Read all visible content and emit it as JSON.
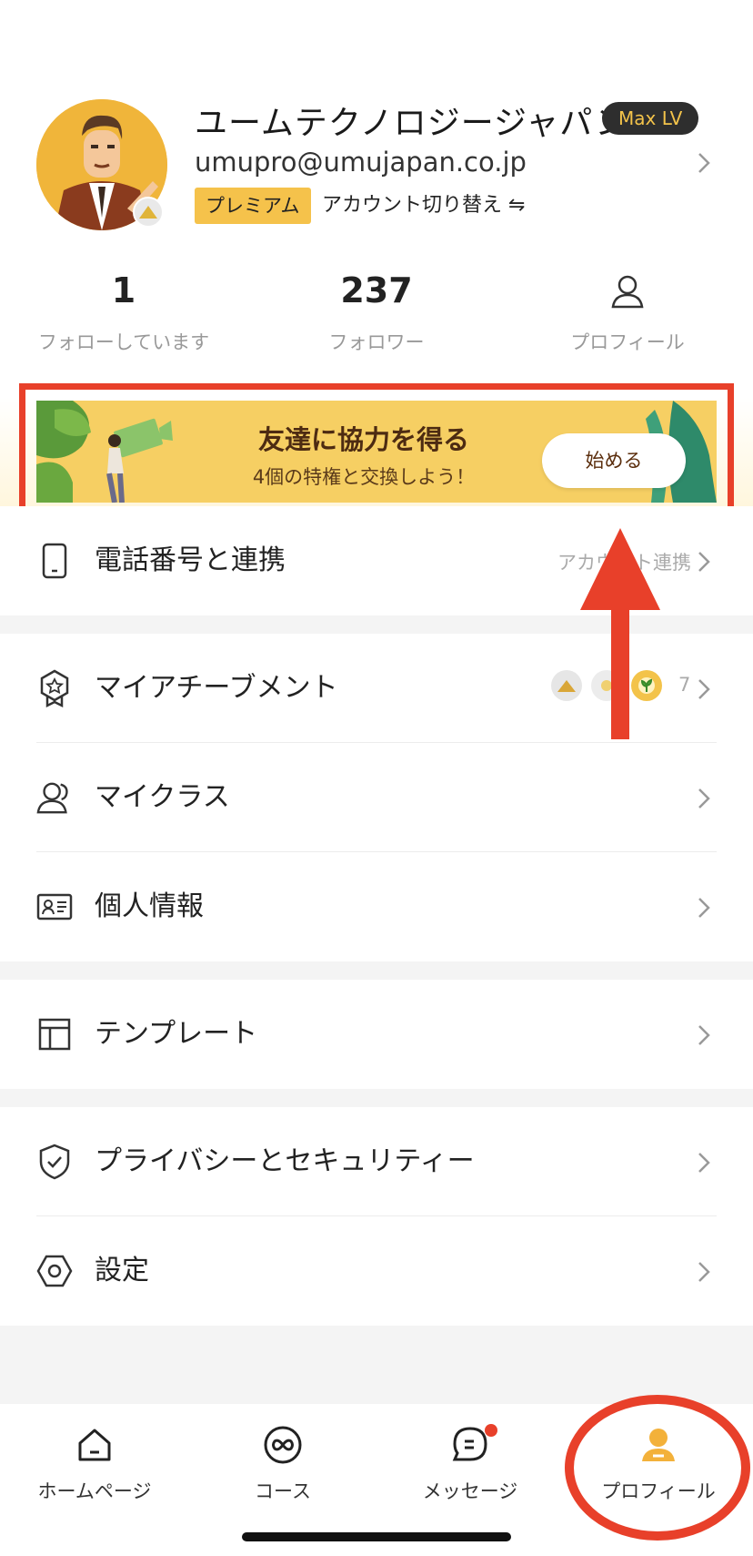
{
  "profile": {
    "name": "ユームテクノロジージャパン",
    "level_badge": "Max LV",
    "email": "umupro@umujapan.co.jp",
    "premium_label": "プレミアム",
    "switch_account_label": "アカウント切り替え ⇋"
  },
  "stats": [
    {
      "value": "1",
      "label": "フォローしています"
    },
    {
      "value": "237",
      "label": "フォロワー"
    },
    {
      "icon": "person-outline-icon",
      "label": "プロフィール"
    }
  ],
  "banner": {
    "title": "友達に協力を得る",
    "subtitle": "4個の特権と交換しよう！",
    "button_label": "始める"
  },
  "menu": {
    "phone": {
      "label": "電話番号と連携",
      "trail": "アカウント連携",
      "icon": "phone-icon"
    },
    "achievement": {
      "label": "マイアチーブメント",
      "count": "7",
      "icon": "award-badge-icon"
    },
    "my_class": {
      "label": "マイクラス",
      "icon": "people-icon"
    },
    "personal_info": {
      "label": "個人情報",
      "icon": "id-card-icon"
    },
    "template": {
      "label": "テンプレート",
      "icon": "layout-icon"
    },
    "privacy": {
      "label": "プライバシーとセキュリティー",
      "icon": "shield-check-icon"
    },
    "settings": {
      "label": "設定",
      "icon": "hexagon-gear-icon"
    }
  },
  "tabs": [
    {
      "label": "ホームページ",
      "icon": "home-icon"
    },
    {
      "label": "コース",
      "icon": "infinity-icon"
    },
    {
      "label": "メッセージ",
      "icon": "chat-icon"
    },
    {
      "label": "プロフィール",
      "icon": "profile-filled-icon",
      "active": true
    }
  ],
  "colors": {
    "accent": "#f5c24b",
    "annotation_red": "#e8402a",
    "banner_bg": "#f6cf63"
  }
}
